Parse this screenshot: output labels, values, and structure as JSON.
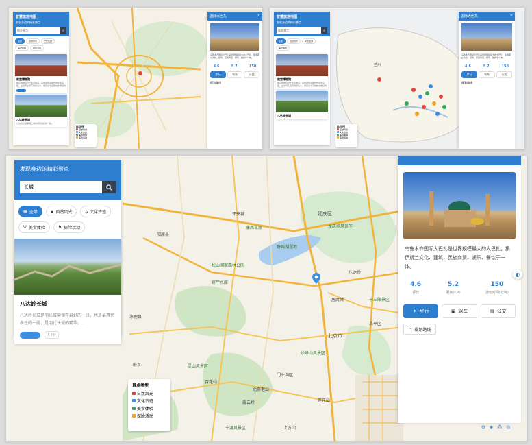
{
  "left_panel": {
    "title": "发现身边的精彩景点",
    "small_title": "智慧旅游地图",
    "small_subtitle": "发现身边的精彩景点",
    "search_value": "长城",
    "search_placeholder": "搜索景点",
    "filters": [
      {
        "label": "全部",
        "icon": "grid-icon",
        "active": true
      },
      {
        "label": "自然风光",
        "icon": "mountain-icon",
        "active": false
      },
      {
        "label": "文化古迹",
        "icon": "temple-icon",
        "active": false
      },
      {
        "label": "美食体验",
        "icon": "food-icon",
        "active": false
      },
      {
        "label": "探险活动",
        "icon": "hiking-icon",
        "active": false
      }
    ],
    "small_cards": [
      {
        "title": "故宫博物院",
        "desc": "故宫博物院位于北京故宫，是中国明清两代的皇家宫殿，是世界上现存规模最大、保存最为完整的木质结构古建筑之一。",
        "badge": ""
      },
      {
        "title": "八达岭长城",
        "desc": "八达岭长城是明长城中保存最好的一段。",
        "badge": ""
      }
    ],
    "card": {
      "title": "八达岭长城",
      "desc": "八达岭长城是明长城中保存最好的一段，也是最具代表性的一段，是明代长城的精华。...",
      "rating": "4.7分"
    }
  },
  "right_panel": {
    "header": "国际大巴扎",
    "close": "×",
    "description": "乌鲁木齐国际大巴扎是世界规模最大的大巴扎，集伊斯兰文化、建筑、民族商贸、娱乐、餐饮于一体。",
    "stats": [
      {
        "value": "4.6",
        "label": "评分"
      },
      {
        "value": "5.2",
        "label": "距离(KM)"
      },
      {
        "value": "150",
        "label": "游玩时间(分钟)"
      }
    ],
    "transport": [
      {
        "label": "步行",
        "icon": "walk-icon",
        "active": true
      },
      {
        "label": "驾车",
        "icon": "car-icon",
        "active": false
      },
      {
        "label": "公交",
        "icon": "bus-icon",
        "active": false
      }
    ],
    "route_button": "规划路线"
  },
  "legend": {
    "title": "景点类型",
    "items": [
      {
        "label": "自然风光",
        "color": "#e0463b"
      },
      {
        "label": "文化古迹",
        "color": "#3b8ee0"
      },
      {
        "label": "美食体验",
        "color": "#2faa5a"
      },
      {
        "label": "探险活动",
        "color": "#f0a020"
      }
    ]
  },
  "map_labels": [
    "延庆区",
    "龙庆峡风景区",
    "康西草原",
    "野鸭湖湿地",
    "八达岭",
    "居庸关",
    "十三陵景区",
    "北京市",
    "昌平区",
    "门头沟区",
    "妙峰山风景区",
    "百花山",
    "灵山风景区",
    "莲花山",
    "上方山",
    "十渡风景区",
    "霞云岭",
    "北京老山",
    "松山国家森林公园",
    "官厅水库",
    "怀来县",
    "涿鹿县",
    "蔚县",
    "阳原县"
  ],
  "small_map_labels": [
    "兰州"
  ],
  "colors": {
    "accent": "#2f7fd1",
    "dark": "#36414f"
  }
}
